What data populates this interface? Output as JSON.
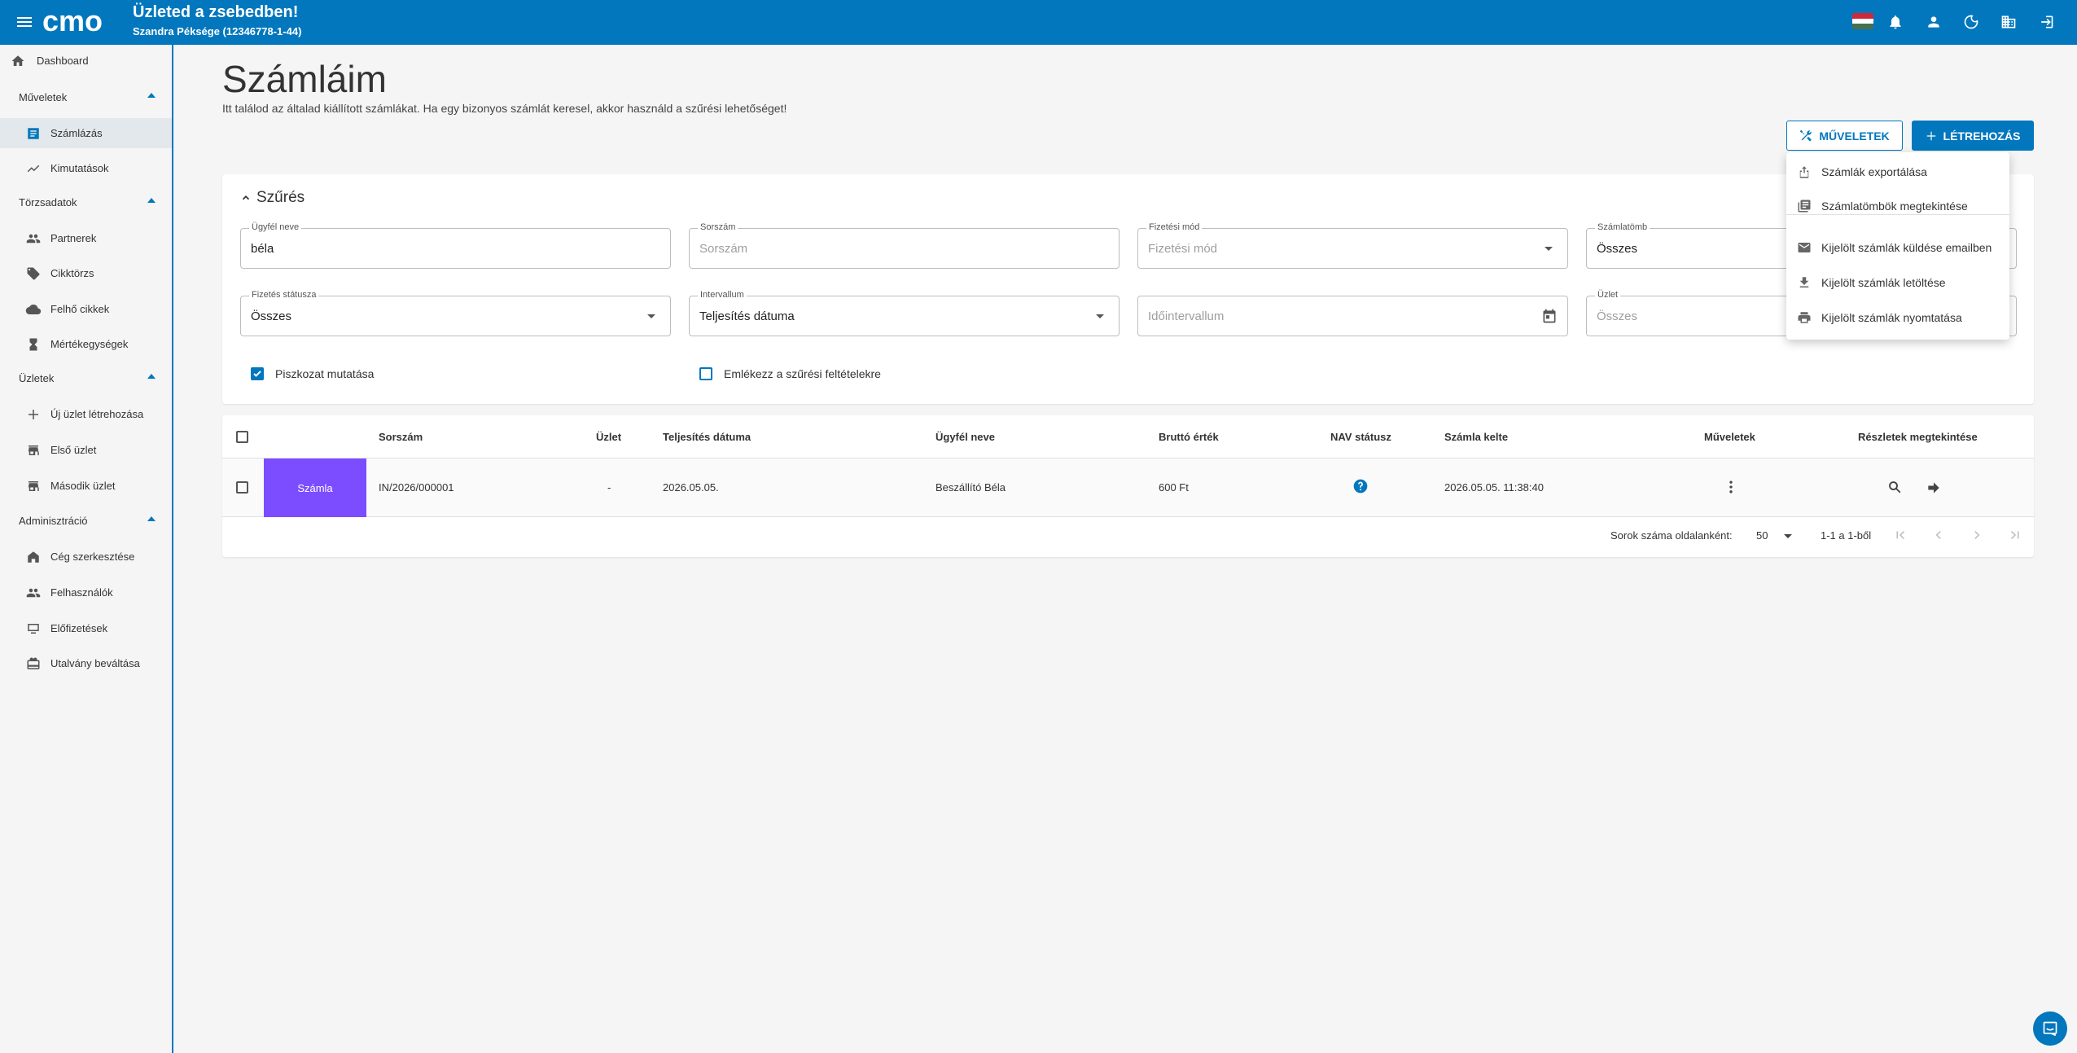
{
  "header": {
    "logo_text": "cmo",
    "title": "Üzleted a zsebedben!",
    "subtitle": "Szandra Péksége (12346778-1-44)"
  },
  "sidebar": {
    "dashboard": "Dashboard",
    "sections": [
      {
        "label": "Műveletek",
        "items": [
          "Számlázás",
          "Kimutatások"
        ]
      },
      {
        "label": "Törzsadatok",
        "items": [
          "Partnerek",
          "Cikktörzs",
          "Felhő cikkek",
          "Mértékegységek"
        ]
      },
      {
        "label": "Üzletek",
        "items": [
          "Új üzlet létrehozása",
          "Első üzlet",
          "Második üzlet"
        ]
      },
      {
        "label": "Adminisztráció",
        "items": [
          "Cég szerkesztése",
          "Felhasználók",
          "Előfizetések",
          "Utalvány beváltása"
        ]
      }
    ]
  },
  "main": {
    "title": "Számláim",
    "description": "Itt találod az általad kiállított számlákat. Ha egy bizonyos számlát keresel, akkor használd a szűrési lehetőséget!",
    "ops_button": "MŰVELETEK",
    "create_button": "LÉTREHOZÁS"
  },
  "filter": {
    "title": "Szűrés",
    "customer_name": {
      "label": "Ügyfél neve",
      "value": "béla"
    },
    "serial": {
      "label": "Sorszám",
      "placeholder": "Sorszám"
    },
    "payment_method": {
      "label": "Fizetési mód",
      "placeholder": "Fizetési mód"
    },
    "invoice_block": {
      "label": "Számlatömb",
      "value": "Összes"
    },
    "payment_status": {
      "label": "Fizetés státusza",
      "value": "Összes"
    },
    "interval": {
      "label": "Intervallum",
      "value": "Teljesítés dátuma"
    },
    "date_range": {
      "placeholder": "Időintervallum"
    },
    "shop": {
      "label": "Üzlet",
      "placeholder": "Összes"
    },
    "show_draft": {
      "label": "Piszkozat mutatása",
      "checked": true
    },
    "remember": {
      "label": "Emlékezz a szűrési feltételekre",
      "checked": false
    }
  },
  "table": {
    "columns": [
      "Sorszám",
      "Üzlet",
      "Teljesítés dátuma",
      "Ügyfél neve",
      "Bruttó érték",
      "NAV státusz",
      "Számla kelte",
      "Műveletek",
      "Részletek megtekintése"
    ],
    "rows": [
      {
        "type": "Számla",
        "serial": "IN/2026/000001",
        "shop": "-",
        "fulfillment_date": "2026.05.05.",
        "customer": "Beszállító Béla",
        "gross": "600 Ft",
        "nav_status": "unknown",
        "issued": "2026.05.05. 11:38:40"
      }
    ],
    "pager": {
      "rows_per_page_label": "Sorok száma oldalanként:",
      "rows_per_page": "50",
      "range": "1-1 a 1-ből"
    }
  },
  "ops_menu": {
    "items": [
      "Számlák exportálása",
      "Számlatömbök megtekintése",
      "Kijelölt számlák küldése emailben",
      "Kijelölt számlák letöltése",
      "Kijelölt számlák nyomtatása"
    ]
  },
  "colors": {
    "primary": "#0277bd",
    "invoice_chip": "#7c4dff",
    "background": "#f5f5f5"
  }
}
